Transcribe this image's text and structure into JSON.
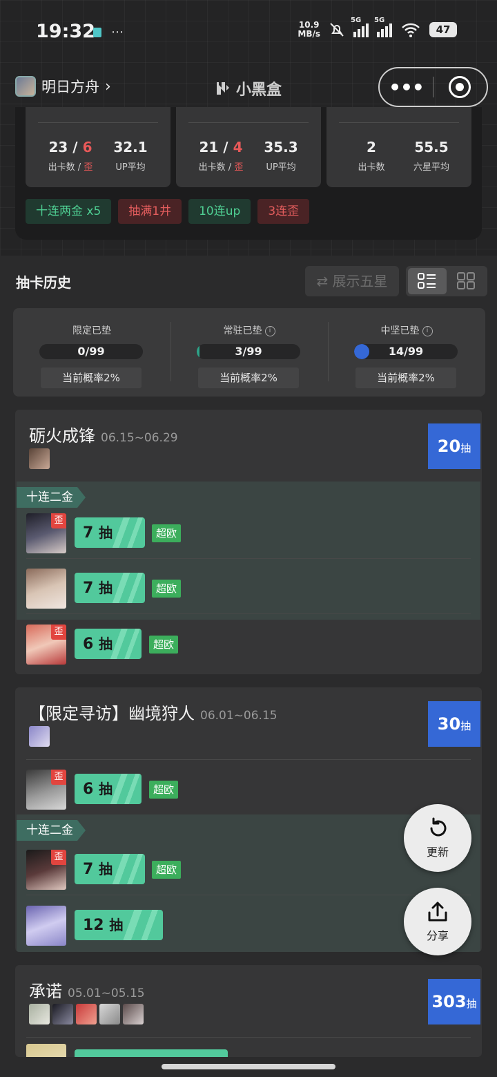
{
  "status_bar": {
    "time": "19:32",
    "net_speed_value": "10.9",
    "net_speed_unit": "MB/s",
    "sim1": "5G",
    "sim2": "5G",
    "wifi_band": "6",
    "battery": "47"
  },
  "nav": {
    "game_name": "明日方舟",
    "brand": "小黑盒"
  },
  "stats": [
    {
      "pulls": "23",
      "off": "6",
      "avg": "32.1",
      "label_pulls": "出卡数",
      "label_off": "歪",
      "label_avg": "UP平均"
    },
    {
      "pulls": "21",
      "off": "4",
      "avg": "35.3",
      "label_pulls": "出卡数",
      "label_off": "歪",
      "label_avg": "UP平均"
    },
    {
      "pulls": "2",
      "avg": "55.5",
      "label_pulls": "出卡数",
      "label_avg": "六星平均"
    }
  ],
  "tags": [
    "十连两金 x5",
    "抽满1井",
    "10连up",
    "3连歪"
  ],
  "history": {
    "title": "抽卡历史",
    "toggle_label": "⇄ 展示五星"
  },
  "pity": [
    {
      "title": "限定已垫",
      "value": "0/99",
      "progress": 0,
      "prob": "当前概率2%"
    },
    {
      "title": "常驻已垫",
      "value": "3/99",
      "progress": 0.03,
      "prob": "当前概率2%"
    },
    {
      "title": "中坚已垫",
      "value": "14/99",
      "progress": 0.14,
      "prob": "当前概率2%"
    }
  ],
  "pools": [
    {
      "name": "砺火成锋",
      "date": "06.15~06.29",
      "count": "20",
      "count_unit": "抽",
      "ten_label": "十连二金",
      "rows": [
        {
          "pulls": "7",
          "unit": "抽",
          "luck": "超欧",
          "off": "歪"
        },
        {
          "pulls": "7",
          "unit": "抽",
          "luck": "超欧"
        },
        {
          "pulls": "6",
          "unit": "抽",
          "luck": "超欧",
          "off": "歪"
        }
      ]
    },
    {
      "name": "【限定寻访】幽境狩人",
      "date": "06.01~06.15",
      "count": "30",
      "count_unit": "抽",
      "ten_label": "十连二金",
      "rows": [
        {
          "pulls": "6",
          "unit": "抽",
          "luck": "超欧",
          "off": "歪"
        },
        {
          "pulls": "7",
          "unit": "抽",
          "luck": "超欧",
          "off": "歪"
        },
        {
          "pulls": "12",
          "unit": "抽"
        }
      ]
    },
    {
      "name": "承诺",
      "date": "05.01~05.15",
      "count": "303",
      "count_unit": "抽"
    }
  ],
  "fab": {
    "refresh": "更新",
    "share": "分享"
  },
  "colors": {
    "accent_blue": "#3568d6",
    "green": "#52c99c",
    "red": "#e85959"
  }
}
